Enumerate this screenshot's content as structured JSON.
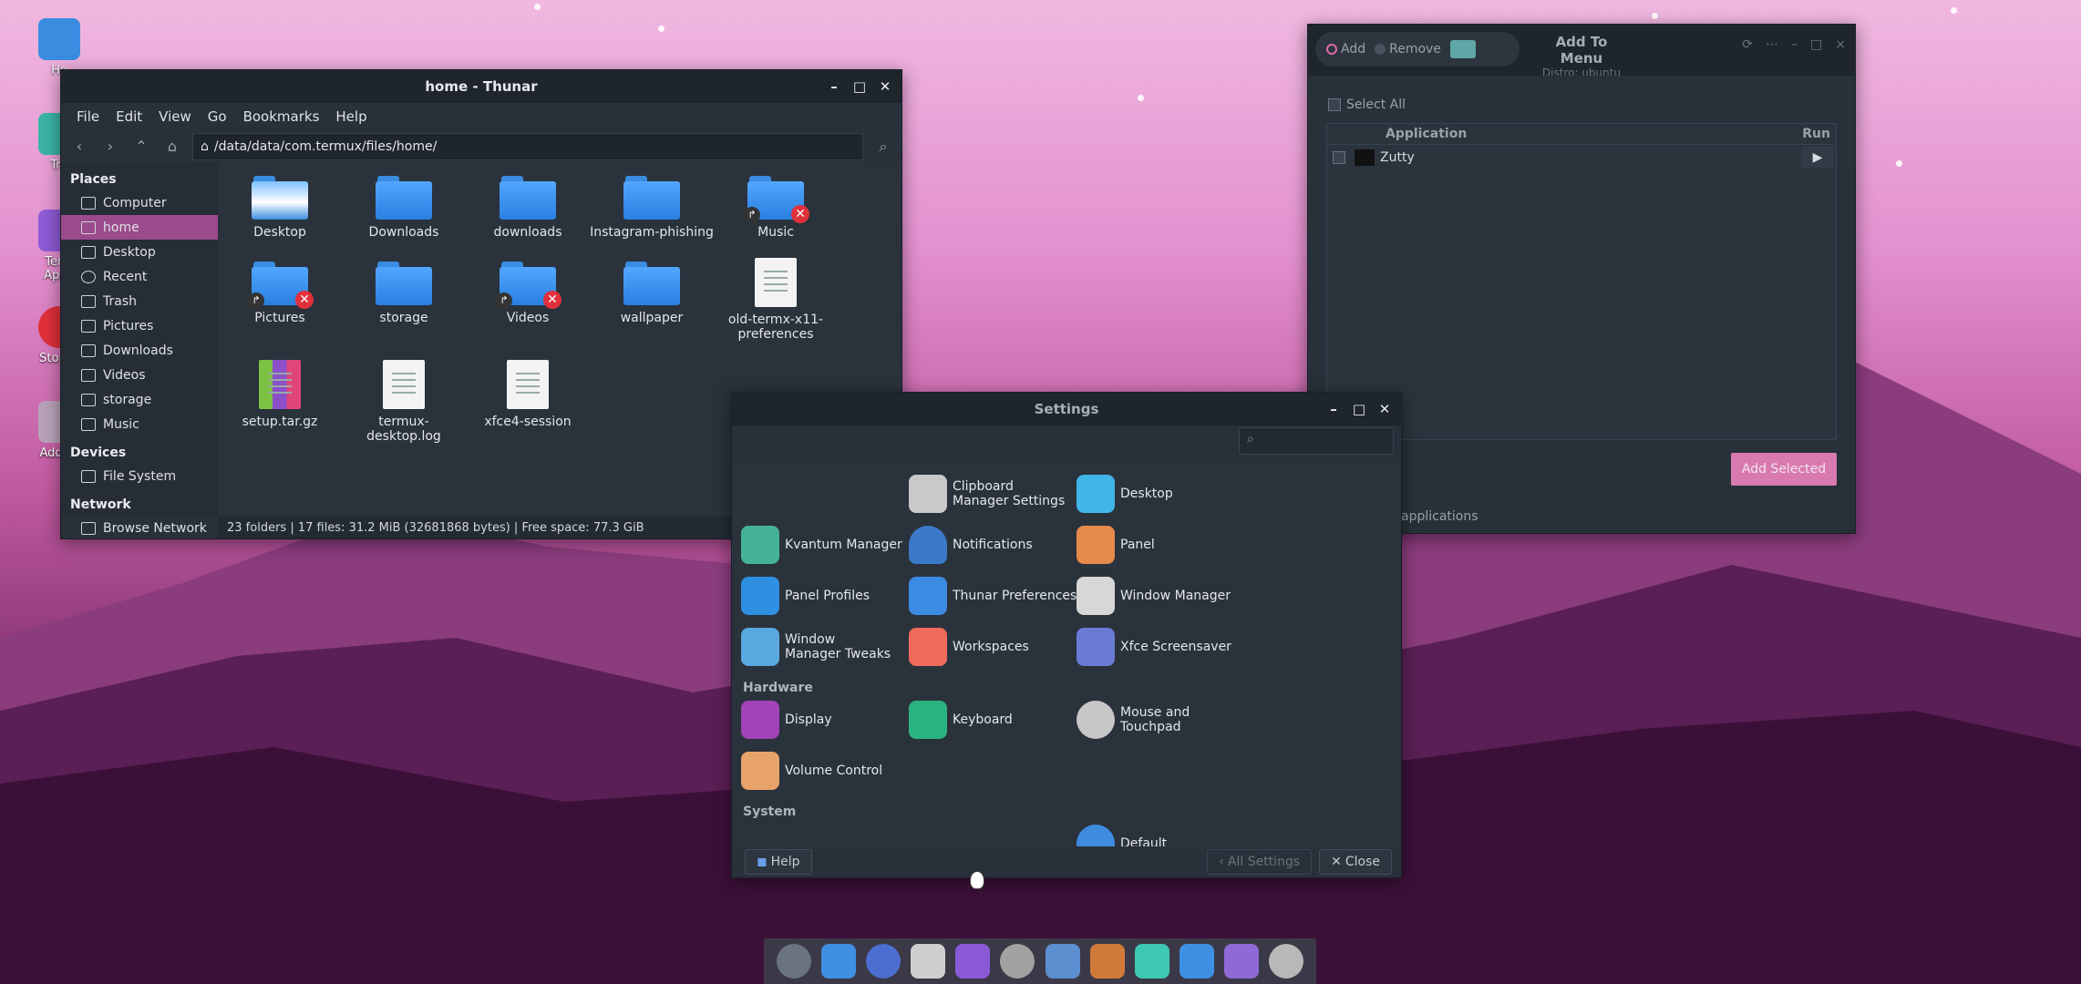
{
  "desktop": {
    "icons": [
      {
        "label": "Ho",
        "icon": "home-folder-icon"
      },
      {
        "label": "Tra",
        "icon": "trash-icon"
      },
      {
        "label": "Term\nAppS",
        "icon": "termux-app-store-icon"
      },
      {
        "label": "Stop D",
        "icon": "stop-icon"
      },
      {
        "label": "Add To",
        "icon": "add-to-menu-icon"
      }
    ]
  },
  "thunar": {
    "title": "home - Thunar",
    "menu": [
      "File",
      "Edit",
      "View",
      "Go",
      "Bookmarks",
      "Help"
    ],
    "path": "/data/data/com.termux/files/home/",
    "places_heading": "Places",
    "places": [
      "Computer",
      "home",
      "Desktop",
      "Recent",
      "Trash",
      "Pictures",
      "Downloads",
      "Videos",
      "storage",
      "Music"
    ],
    "devices_heading": "Devices",
    "devices": [
      "File System"
    ],
    "network_heading": "Network",
    "network": [
      "Browse Network"
    ],
    "files": [
      {
        "name": "Desktop",
        "kind": "desktop-folder"
      },
      {
        "name": "Downloads",
        "kind": "folder"
      },
      {
        "name": "downloads",
        "kind": "folder"
      },
      {
        "name": "Instagram-phishing",
        "kind": "folder"
      },
      {
        "name": "Music",
        "kind": "broken-link-folder"
      },
      {
        "name": "Pictures",
        "kind": "broken-link-folder"
      },
      {
        "name": "storage",
        "kind": "folder"
      },
      {
        "name": "Videos",
        "kind": "broken-link-folder"
      },
      {
        "name": "wallpaper",
        "kind": "folder"
      },
      {
        "name": "old-termx-x11-\npreferences",
        "kind": "document"
      },
      {
        "name": "setup.tar.gz",
        "kind": "archive"
      },
      {
        "name": "termux-desktop.log",
        "kind": "document"
      },
      {
        "name": "xfce4-session",
        "kind": "document"
      }
    ],
    "status": "23 folders  |  17 files: 31.2 MiB (32681868 bytes)  |  Free space: 77.3 GiB"
  },
  "settings": {
    "title": "Settings",
    "items": [
      {
        "label": "Clipboard Manager Settings",
        "icon": "clipboard-icon",
        "color": "#c9c9c9"
      },
      {
        "label": "Desktop",
        "icon": "monitor-icon",
        "color": "#41b4e8"
      },
      {
        "label": "Kvantum Manager",
        "icon": "kvantum-icon",
        "color": "#45b39a"
      },
      {
        "label": "Notifications",
        "icon": "bell-icon",
        "color": "#3b79c9"
      },
      {
        "label": "Panel",
        "icon": "panel-icon",
        "color": "#e68a4a"
      },
      {
        "label": "Panel Profiles",
        "icon": "panel-profiles-icon",
        "color": "#2f8fe0"
      },
      {
        "label": "Thunar Preferences",
        "icon": "thunar-icon",
        "color": "#3c8be3"
      },
      {
        "label": "Window Manager",
        "icon": "window-manager-icon",
        "color": "#d7d7d7"
      },
      {
        "label": "Window Manager Tweaks",
        "icon": "wm-tweaks-icon",
        "color": "#5aa8e0"
      },
      {
        "label": "Workspaces",
        "icon": "workspaces-icon",
        "color": "#ef6a5a"
      },
      {
        "label": "Xfce Screensaver",
        "icon": "screensaver-icon",
        "color": "#6a7bd6"
      },
      {
        "label": "Display",
        "icon": "display-icon",
        "color": "#a144b8"
      },
      {
        "label": "Keyboard",
        "icon": "keyboard-icon",
        "color": "#2bb37f"
      },
      {
        "label": "Mouse and Touchpad",
        "icon": "mouse-icon",
        "color": "#c7c7c7"
      },
      {
        "label": "Volume Control",
        "icon": "volume-icon",
        "color": "#e8a36a"
      },
      {
        "label": "Default",
        "icon": "default-apps-icon",
        "color": "#3e8be0"
      }
    ],
    "groups": [
      "Hardware",
      "System"
    ],
    "help": "Help",
    "all_settings": "All Settings",
    "close": "Close"
  },
  "add_to_menu": {
    "title": "Add To Menu",
    "subtitle": "Distro: ubuntu",
    "add_label": "Add",
    "remove_label": "Remove",
    "select_all": "Select All",
    "col_application": "Application",
    "col_run": "Run",
    "rows": [
      {
        "name": "Zutty"
      }
    ],
    "add_selected": "Add Selected",
    "footer": "applications"
  },
  "dock": {
    "icons": [
      "app-menu-icon",
      "thunar-dock-icon",
      "browser-icon",
      "terminal-icon",
      "app-store-icon",
      "settings-dock-icon",
      "text-editor-icon",
      "screenshot-icon",
      "trash-dock-icon",
      "files-dock-icon",
      "tweaks-icon",
      "system-settings-icon"
    ]
  }
}
